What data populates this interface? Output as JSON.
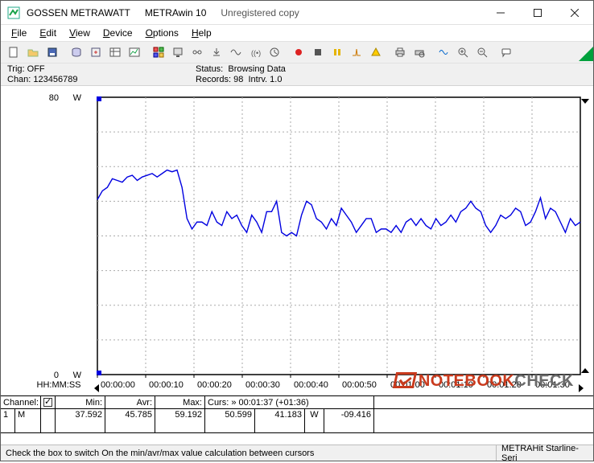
{
  "title": {
    "company": "GOSSEN METRAWATT",
    "product": "METRAwin 10",
    "state": "Unregistered copy"
  },
  "menus": [
    "File",
    "Edit",
    "View",
    "Device",
    "Options",
    "Help"
  ],
  "status_strip": {
    "trig_label": "Trig:",
    "trig_value": "OFF",
    "chan_label": "Chan:",
    "chan_value": "123456789",
    "status_label": "Status:",
    "status_value": "Browsing Data",
    "records_label": "Records:",
    "records_value": "98",
    "intrv_label": "Intrv.",
    "intrv_value": "1.0"
  },
  "table": {
    "head": {
      "channel": "Channel:",
      "min": "Min:",
      "avr": "Avr:",
      "max": "Max:",
      "curs": "Curs: » 00:01:37 (+01:36)"
    },
    "row": {
      "ch": "1",
      "chmark": "M",
      "checked": true,
      "min": "37.592",
      "avr": "45.785",
      "max": "59.192",
      "cursA": "50.599",
      "cursB": "41.183",
      "unit": "W",
      "diff": "-09.416"
    }
  },
  "statusbar": {
    "hint": "Check the box to switch On the min/avr/max value calculation between cursors",
    "device": "METRAHit Starline-Seri"
  },
  "axis": {
    "ymax": "80",
    "ymin": "0",
    "unit": "W",
    "xunit": "HH:MM:SS",
    "xticks": [
      "00:00:00",
      "00:00:10",
      "00:00:20",
      "00:00:30",
      "00:00:40",
      "00:00:50",
      "00:01:00",
      "00:01:10",
      "00:01:20",
      "00:01:30"
    ]
  },
  "watermark": {
    "a": "NOTEBOOK",
    "b": "CHECK"
  },
  "chart_data": {
    "type": "line",
    "title": "",
    "xlabel": "HH:MM:SS",
    "ylabel": "W",
    "ylim": [
      0,
      80
    ],
    "x_seconds_step": 1,
    "values": [
      50.5,
      53,
      54,
      56.5,
      56,
      55.5,
      57,
      57.5,
      56,
      57,
      57.5,
      58,
      57,
      58,
      59,
      58.5,
      59,
      54,
      45,
      42,
      44,
      44,
      43,
      47,
      44,
      43,
      47,
      45,
      46,
      43,
      41,
      46,
      44,
      41,
      47,
      47,
      50,
      41,
      40,
      41,
      40,
      46,
      50,
      49,
      45,
      44,
      42,
      45,
      43,
      48,
      46,
      44,
      41,
      43,
      45,
      45,
      41,
      42,
      42,
      41,
      43,
      41,
      44,
      45,
      43,
      45,
      43,
      42,
      45,
      43,
      44,
      46,
      44,
      47,
      48,
      50,
      48,
      47,
      43,
      41,
      43,
      46,
      45,
      46,
      48,
      47,
      43,
      44,
      47,
      51,
      45,
      48,
      47,
      44,
      41,
      45,
      43,
      44
    ]
  }
}
